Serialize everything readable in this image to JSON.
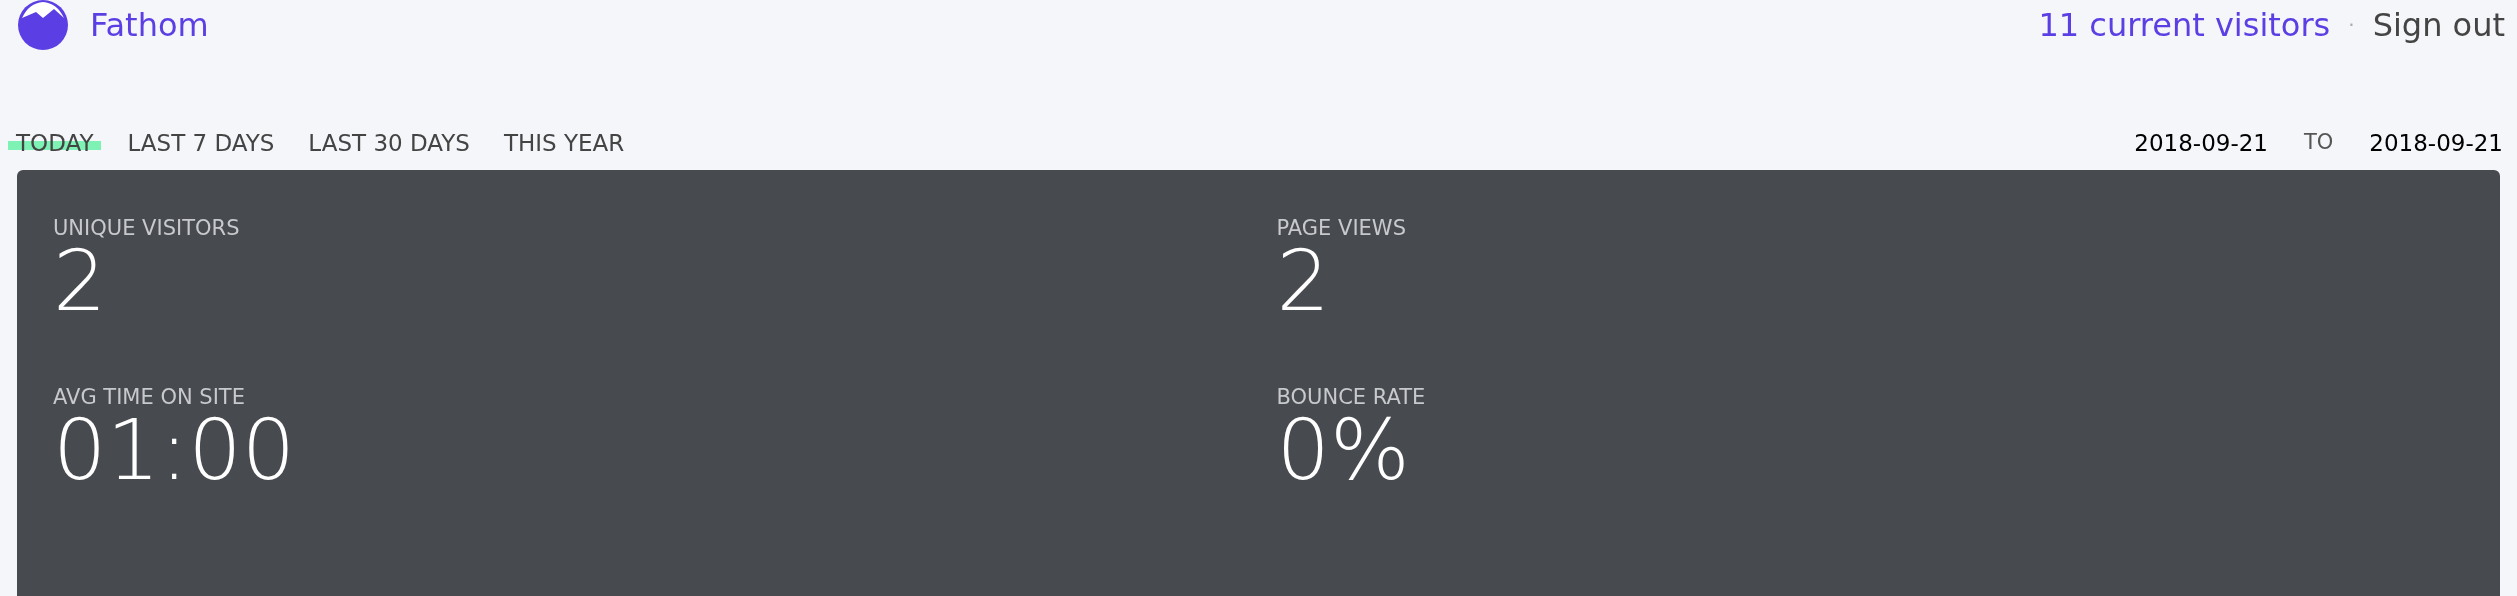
{
  "brand": {
    "name": "Fathom"
  },
  "header": {
    "visitors_link": "11 current visitors",
    "separator": "·",
    "sign_out": "Sign out"
  },
  "tabs": [
    {
      "label": "TODAY",
      "selected": true
    },
    {
      "label": "LAST 7 DAYS",
      "selected": false
    },
    {
      "label": "LAST 30 DAYS",
      "selected": false
    },
    {
      "label": "THIS YEAR",
      "selected": false
    }
  ],
  "date_range": {
    "start": "2018-09-21",
    "to": "TO",
    "end": "2018-09-21"
  },
  "stats": [
    {
      "label": "UNIQUE VISITORS",
      "value": "2"
    },
    {
      "label": "PAGE VIEWS",
      "value": "2"
    },
    {
      "label": "AVG TIME ON SITE",
      "value": "01:00"
    },
    {
      "label": "BOUNCE RATE",
      "value": "0%"
    }
  ]
}
